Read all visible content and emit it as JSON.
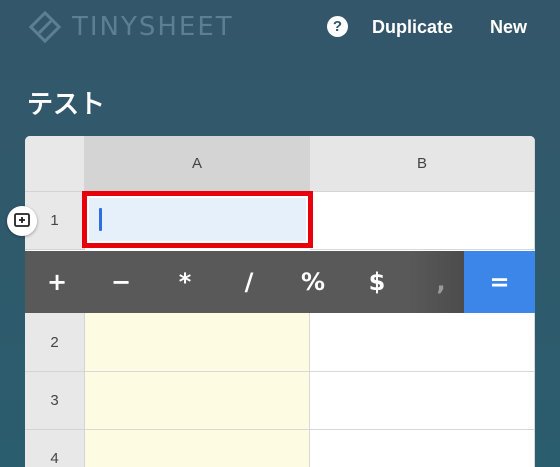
{
  "app": {
    "logo_text": "TINYSHEET",
    "help_label": "?",
    "duplicate_label": "Duplicate",
    "new_label": "New"
  },
  "sheet": {
    "title": "テスト",
    "columns": [
      "A",
      "B"
    ],
    "rows": [
      "1",
      "2",
      "3",
      "4"
    ],
    "active_cell": "A1",
    "active_value": ""
  },
  "toolbar": {
    "buttons": [
      "+",
      "−",
      "*",
      "/",
      "%",
      "$",
      ","
    ],
    "equals_label": "=",
    "equals_color": "#3b86e8"
  },
  "icons": {
    "logo": "diamond-logo-icon",
    "add_row": "add-row-icon"
  },
  "colors": {
    "highlight_border": "#e8000b",
    "column_a_fill": "#fefbe3",
    "active_cell_fill": "#e6f0fa"
  }
}
